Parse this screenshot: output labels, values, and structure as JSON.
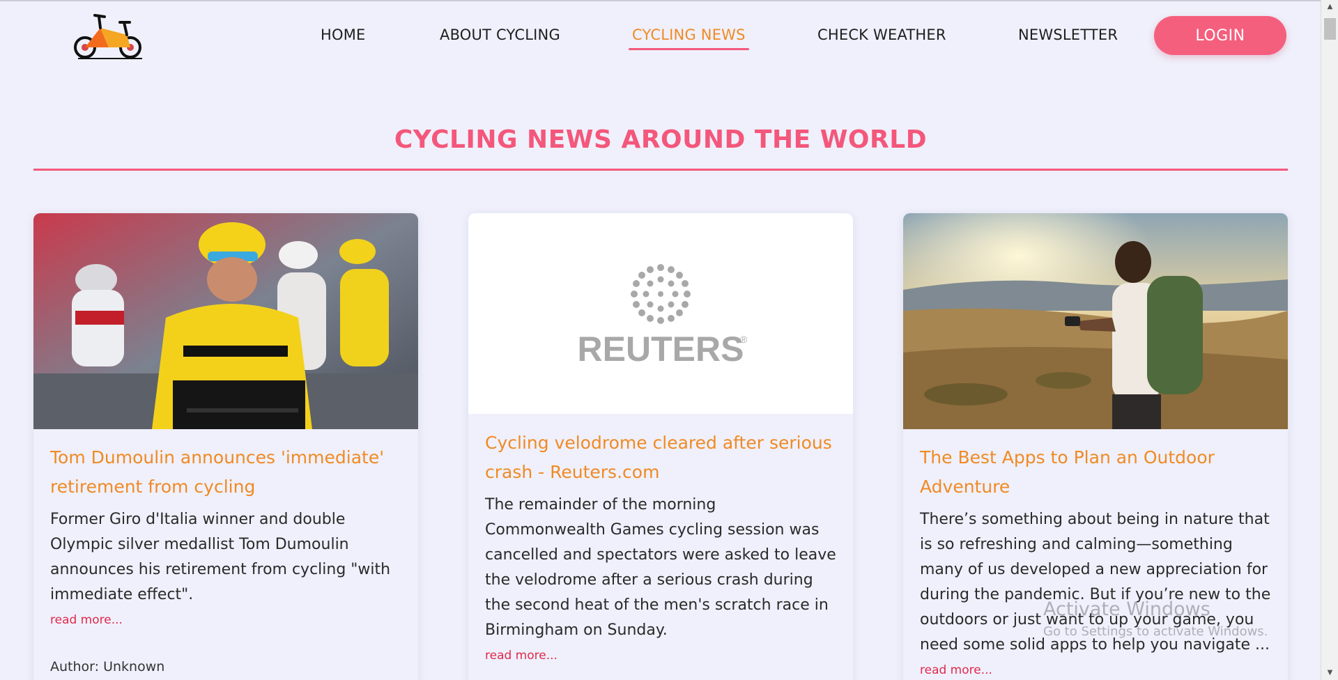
{
  "nav": {
    "items": [
      {
        "label": "HOME"
      },
      {
        "label": "ABOUT CYCLING"
      },
      {
        "label": "CYCLING NEWS",
        "active": true
      },
      {
        "label": "CHECK WEATHER"
      },
      {
        "label": "NEWSLETTER"
      }
    ],
    "login_label": "LOGIN"
  },
  "section": {
    "title": "CYCLING NEWS AROUND THE WORLD"
  },
  "articles": [
    {
      "title": "Tom Dumoulin announces 'immediate' retirement from cycling",
      "description": "Former Giro d'Italia winner and double Olympic silver medallist Tom Dumoulin announces his retirement from cycling \"with immediate effect\".",
      "read_more": "read more...",
      "author": "Author: Unknown"
    },
    {
      "title": "Cycling velodrome cleared after serious crash - Reuters.com",
      "description": "The remainder of the morning Commonwealth Games cycling session was cancelled and spectators were asked to leave the velodrome after a serious crash during the second heat of the men's scratch race in Birmingham on Sunday.",
      "read_more": "read more...",
      "image_logo_text": "REUTERS"
    },
    {
      "title": "The Best Apps to Plan an Outdoor Adventure",
      "description": "There’s something about being in nature that is so refreshing and calming—something many of us developed a new appreciation for during the pandemic. But if you’re new to the outdoors or just want to up your game, you need some solid apps to help you navigate ...",
      "read_more": "read more..."
    }
  ],
  "watermark": {
    "title": "Activate Windows",
    "subtitle": "Go to Settings to activate Windows."
  },
  "colors": {
    "accent": "#f4577b",
    "active_nav": "#f08a24",
    "background": "#eff0fb",
    "link": "#e0294d"
  }
}
